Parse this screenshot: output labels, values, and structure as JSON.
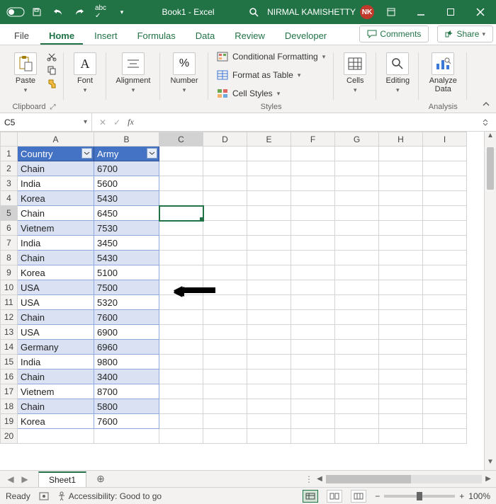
{
  "titlebar": {
    "autosave": "AutoSave",
    "title": "Book1 - Excel",
    "user_name": "NIRMAL KAMISHETTY",
    "user_initials": "NK"
  },
  "ribbon_tabs": {
    "file": "File",
    "home": "Home",
    "insert": "Insert",
    "formulas": "Formulas",
    "data": "Data",
    "review": "Review",
    "developer": "Developer",
    "comments": "Comments",
    "share": "Share"
  },
  "ribbon": {
    "clipboard": {
      "paste": "Paste",
      "label": "Clipboard"
    },
    "font": {
      "btn": "Font",
      "label": "Font"
    },
    "alignment": {
      "btn": "Alignment",
      "label": ""
    },
    "number": {
      "btn": "Number",
      "label": ""
    },
    "styles": {
      "cond": "Conditional Formatting",
      "table": "Format as Table",
      "cell": "Cell Styles",
      "label": "Styles"
    },
    "cells": {
      "btn": "Cells"
    },
    "editing": {
      "btn": "Editing"
    },
    "analysis": {
      "btn": "Analyze Data",
      "label": "Analysis"
    }
  },
  "namebox": {
    "value": "C5"
  },
  "columns": [
    "A",
    "B",
    "C",
    "D",
    "E",
    "F",
    "G",
    "H",
    "I"
  ],
  "table": {
    "headers": {
      "country": "Country",
      "army": "Army"
    },
    "rows": [
      {
        "n": 1,
        "c": "Country",
        "a": "Army",
        "hdr": true
      },
      {
        "n": 2,
        "c": "Chain",
        "a": "6700"
      },
      {
        "n": 3,
        "c": "India",
        "a": "5600"
      },
      {
        "n": 4,
        "c": "Korea",
        "a": "5430"
      },
      {
        "n": 5,
        "c": "Chain",
        "a": "6450"
      },
      {
        "n": 6,
        "c": "Vietnem",
        "a": "7530"
      },
      {
        "n": 7,
        "c": "India",
        "a": "3450"
      },
      {
        "n": 8,
        "c": "Chain",
        "a": "5430"
      },
      {
        "n": 9,
        "c": "Korea",
        "a": "5100"
      },
      {
        "n": 10,
        "c": "USA",
        "a": "7500"
      },
      {
        "n": 11,
        "c": "USA",
        "a": "5320"
      },
      {
        "n": 12,
        "c": "Chain",
        "a": "7600"
      },
      {
        "n": 13,
        "c": "USA",
        "a": "6900"
      },
      {
        "n": 14,
        "c": "Germany",
        "a": "6960"
      },
      {
        "n": 15,
        "c": "India",
        "a": "9800"
      },
      {
        "n": 16,
        "c": "Chain",
        "a": "3400"
      },
      {
        "n": 17,
        "c": "Vietnem",
        "a": "8700"
      },
      {
        "n": 18,
        "c": "Chain",
        "a": "5800"
      },
      {
        "n": 19,
        "c": "Korea",
        "a": "7600"
      }
    ],
    "extra_rows": [
      20
    ]
  },
  "sheettabs": {
    "active": "Sheet1"
  },
  "statusbar": {
    "ready": "Ready",
    "accessibility": "Accessibility: Good to go",
    "zoom": "100%"
  }
}
